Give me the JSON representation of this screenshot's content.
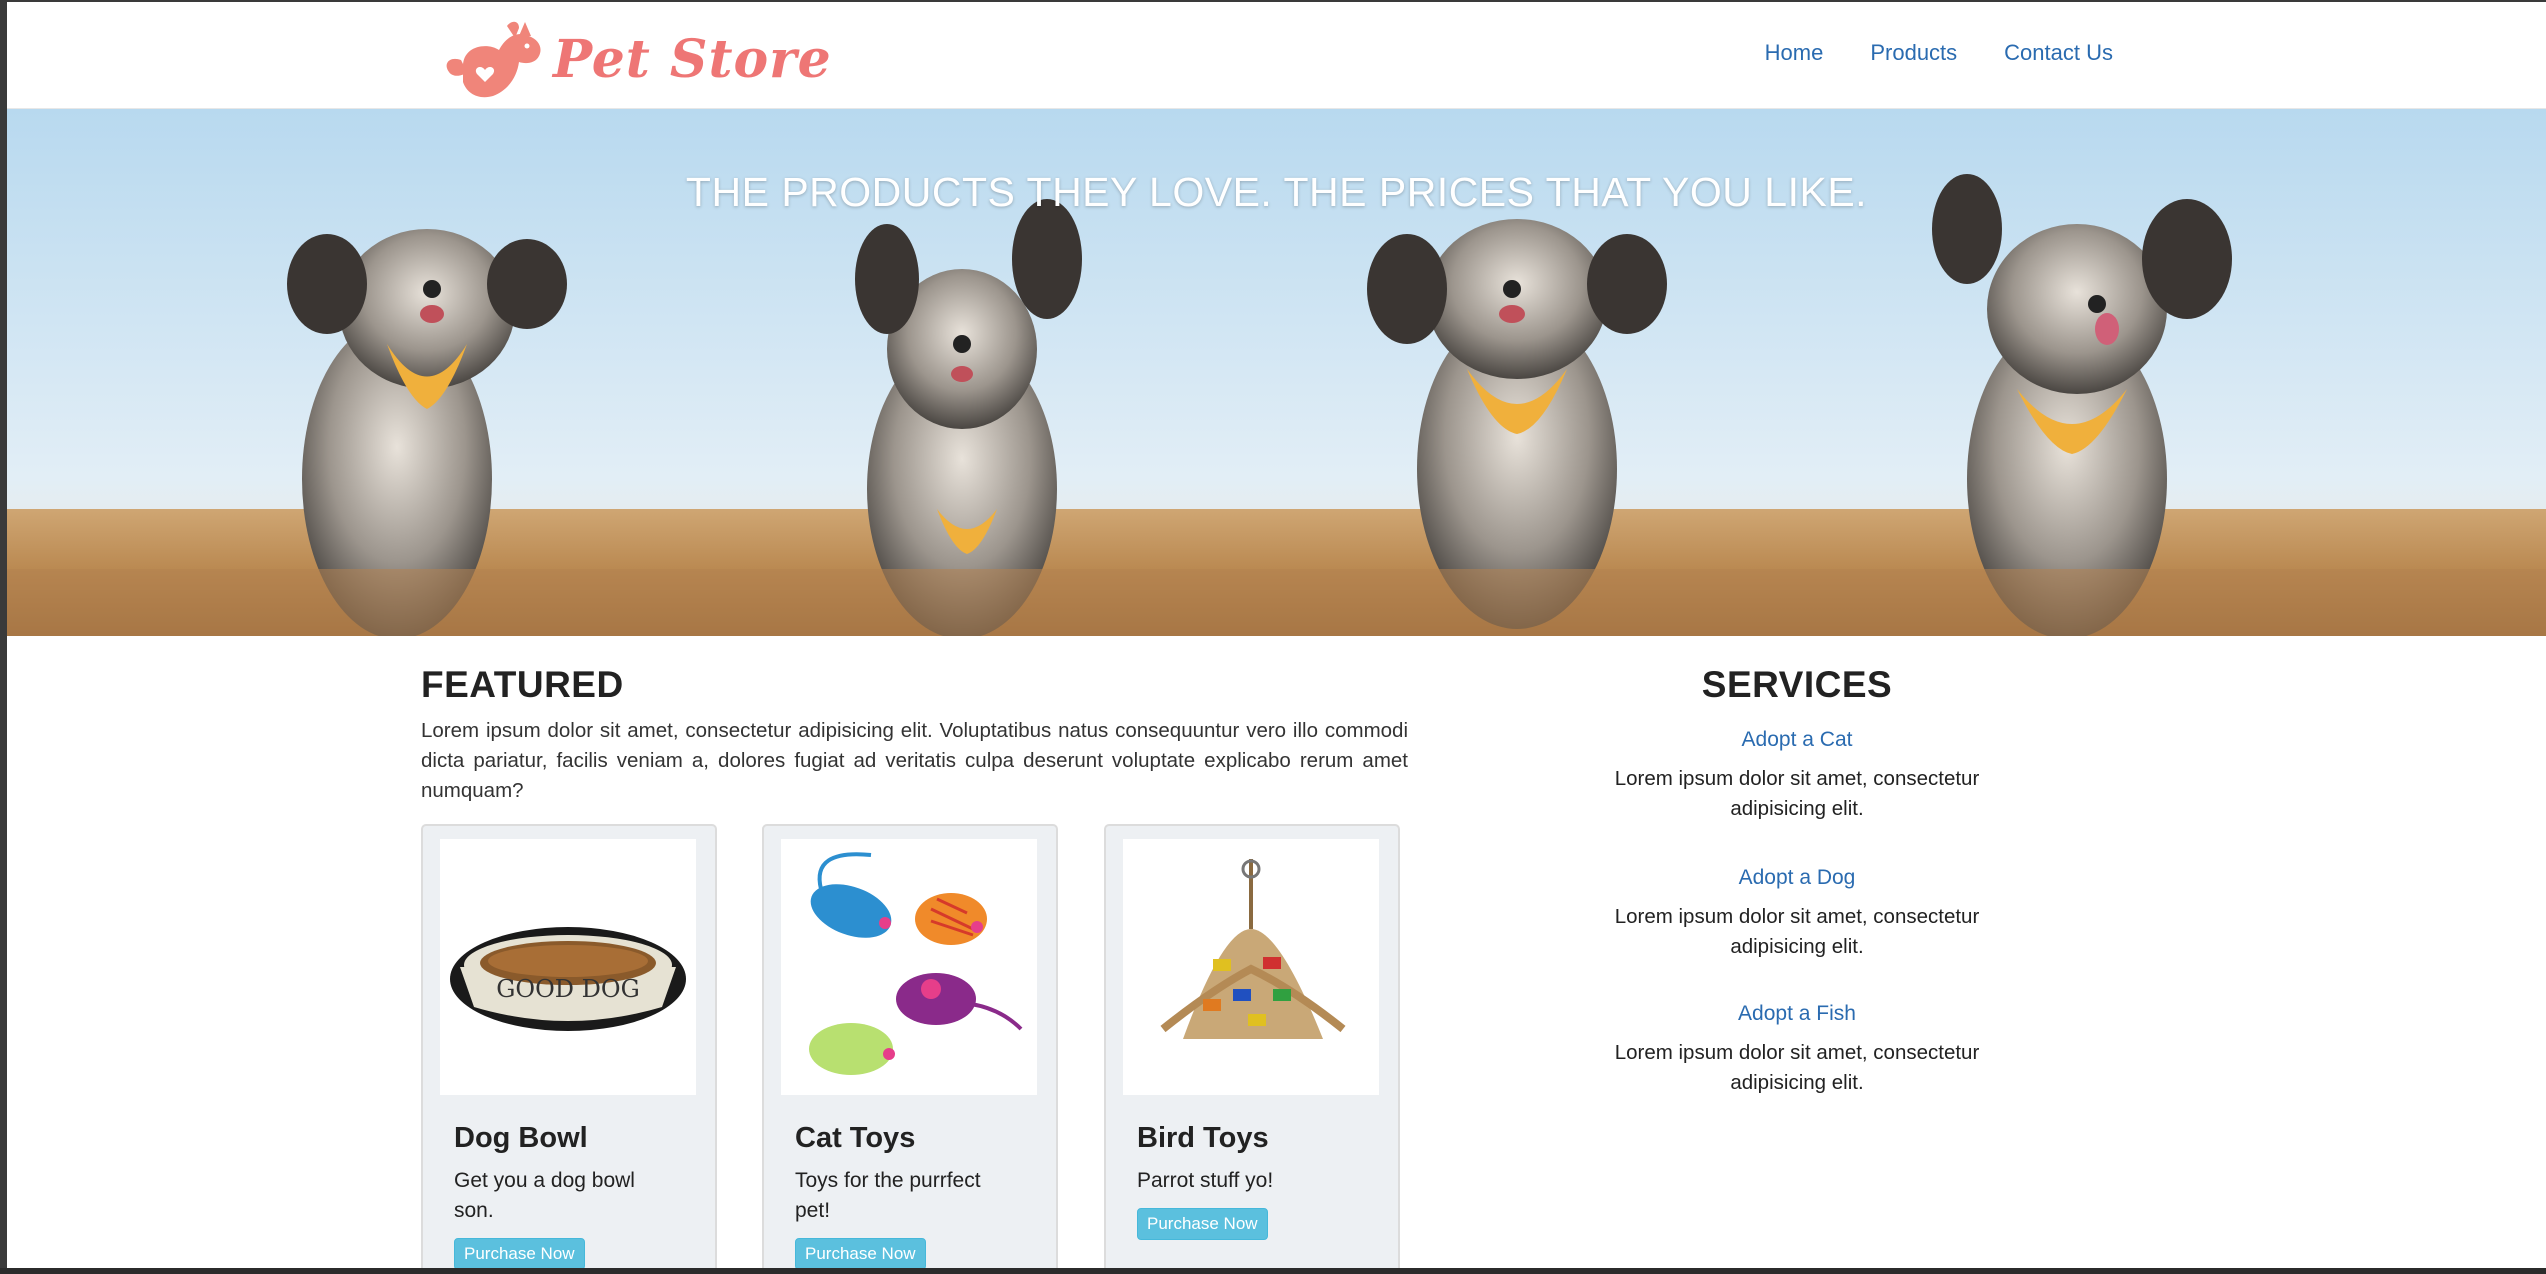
{
  "brand": {
    "name": "Pet Store",
    "color": "#ee7675"
  },
  "nav": {
    "items": [
      {
        "label": "Home"
      },
      {
        "label": "Products"
      },
      {
        "label": "Contact Us"
      }
    ],
    "link_color": "#2a6bb0"
  },
  "hero": {
    "caption": "THE PRODUCTS THEY LOVE. THE PRICES THAT YOU LIKE."
  },
  "featured": {
    "heading": "FEATURED",
    "intro": "Lorem ipsum dolor sit amet, consectetur adipisicing elit. Voluptatibus natus consequuntur vero illo commodi dicta pariatur, facilis veniam a, dolores fugiat ad veritatis culpa deserunt voluptate explicabo rerum amet numquam?",
    "products": [
      {
        "title": "Dog Bowl",
        "description": "Get you a dog bowl son.",
        "button": "Purchase Now",
        "image_icon": "dog-bowl-image",
        "bowl_text": "GOOD DOG"
      },
      {
        "title": "Cat Toys",
        "description": "Toys for the purrfect pet!",
        "button": "Purchase Now",
        "image_icon": "toy-mice-image"
      },
      {
        "title": "Bird Toys",
        "description": "Parrot stuff yo!",
        "button": "Purchase Now",
        "image_icon": "parrot-toy-image"
      }
    ]
  },
  "services": {
    "heading": "SERVICES",
    "items": [
      {
        "link": "Adopt a Cat",
        "text": "Lorem ipsum dolor sit amet, consectetur adipisicing elit."
      },
      {
        "link": "Adopt a Dog",
        "text": "Lorem ipsum dolor sit amet, consectetur adipisicing elit."
      },
      {
        "link": "Adopt a Fish",
        "text": "Lorem ipsum dolor sit amet, consectetur adipisicing elit."
      }
    ]
  },
  "colors": {
    "button": "#5bc0de",
    "card_bg": "#edf0f3"
  }
}
